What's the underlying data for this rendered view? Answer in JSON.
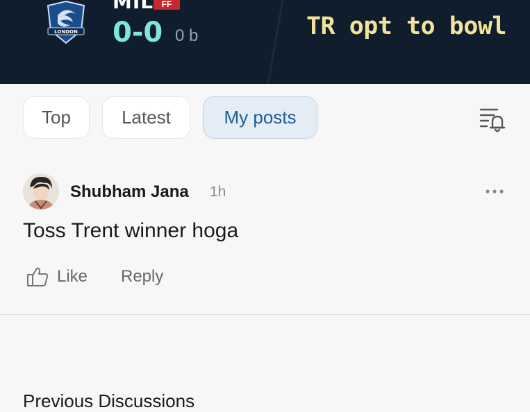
{
  "header": {
    "team_abbr": "MIL",
    "team_badge": "FF",
    "logo_text": "LONDON",
    "score": "0-0",
    "balls": "0 b",
    "status": "TR opt to bowl",
    "colors": {
      "background": "#0f1d2c",
      "score": "#7fe6d8",
      "status": "#f2e39c",
      "badge": "#c7282f"
    }
  },
  "tabs": [
    {
      "label": "Top",
      "active": false
    },
    {
      "label": "Latest",
      "active": false
    },
    {
      "label": "My posts",
      "active": true
    }
  ],
  "toolbar": {
    "notify_icon": "list-bell-icon"
  },
  "post": {
    "author": "Shubham Jana",
    "time": "1h",
    "text": "Toss Trent winner hoga",
    "like_label": "Like",
    "reply_label": "Reply",
    "more_icon": "more-dots-icon",
    "like_icon": "thumbs-up-icon"
  },
  "previous": {
    "heading": "Previous Discussions"
  }
}
